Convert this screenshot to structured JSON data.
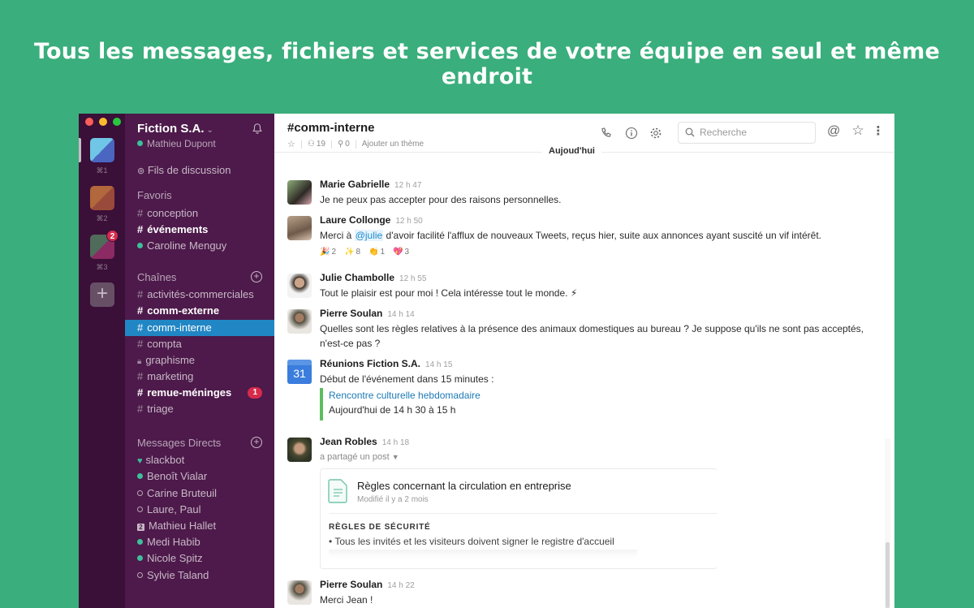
{
  "headline": "Tous les messages, fichiers et services de votre équipe en seul et même endroit",
  "window_controls": {
    "close_color": "#fc5f57",
    "minimize_color": "#fdbc2e",
    "maximize_color": "#27c840"
  },
  "teams": [
    {
      "shortcut": "⌘1",
      "colors": [
        "#6fc6e6",
        "#4a66c1"
      ],
      "badge": null
    },
    {
      "shortcut": "⌘2",
      "colors": [
        "#b2673c",
        "#9a4a3a"
      ],
      "badge": null
    },
    {
      "shortcut": "⌘3",
      "colors": [
        "#4f6b5a",
        "#8b2a63"
      ],
      "badge": "2"
    }
  ],
  "sidebar": {
    "workspace_name": "Fiction S.A.",
    "user_name": "Mathieu Dupont",
    "threads_label": "Fils de discussion",
    "favorites": {
      "title": "Favoris",
      "items": [
        {
          "type": "channel",
          "label": "conception",
          "bold": false
        },
        {
          "type": "channel",
          "label": "événements",
          "bold": true
        },
        {
          "type": "dm-online",
          "label": "Caroline Menguy",
          "bold": false
        }
      ]
    },
    "channels": {
      "title": "Chaînes",
      "items": [
        {
          "type": "channel",
          "label": "activités-commerciales",
          "bold": false
        },
        {
          "type": "channel",
          "label": "comm-externe",
          "bold": true
        },
        {
          "type": "channel",
          "label": "comm-interne",
          "bold": false,
          "selected": true
        },
        {
          "type": "channel",
          "label": "compta",
          "bold": false
        },
        {
          "type": "private",
          "label": "graphisme",
          "bold": false
        },
        {
          "type": "channel",
          "label": "marketing",
          "bold": false
        },
        {
          "type": "channel",
          "label": "remue-méninges",
          "bold": true,
          "badge": "1"
        },
        {
          "type": "channel",
          "label": "triage",
          "bold": false
        }
      ]
    },
    "direct_messages": {
      "title": "Messages Directs",
      "items": [
        {
          "type": "bot",
          "label": "slackbot"
        },
        {
          "type": "online",
          "label": "Benoît Vialar"
        },
        {
          "type": "away",
          "label": "Carine Bruteuil"
        },
        {
          "type": "away",
          "label": "Laure, Paul"
        },
        {
          "type": "group",
          "label": "Mathieu Hallet",
          "count": "2"
        },
        {
          "type": "online",
          "label": "Medi Habib"
        },
        {
          "type": "online",
          "label": "Nicole Spitz"
        },
        {
          "type": "away",
          "label": "Sylvie Taland"
        }
      ]
    }
  },
  "channel_header": {
    "title": "#comm-interne",
    "members": "19",
    "pins": "0",
    "topic_placeholder": "Ajouter un thème",
    "search_placeholder": "Recherche"
  },
  "day_divider": "Aujoud'hui",
  "messages": [
    {
      "author": "Marie Gabrielle",
      "time": "12 h 47",
      "text": "Je ne peux pas accepter pour des raisons personnelles."
    },
    {
      "author": "Laure Collonge",
      "time": "12 h 50",
      "text_before": "Merci à ",
      "mention": "@julie",
      "text_after": " d'avoir facilité l'afflux de nouveaux Tweets, reçus hier, suite aux annonces ayant suscité un vif intérêt.",
      "reactions": [
        {
          "emoji": "🎉",
          "count": "2"
        },
        {
          "emoji": "✨",
          "count": "8"
        },
        {
          "emoji": "👏",
          "count": "1"
        },
        {
          "emoji": "💖",
          "count": "3"
        }
      ]
    },
    {
      "author": "Julie Chambolle",
      "time": "12 h 55",
      "text": "Tout le plaisir est pour moi ! Cela intéresse tout le monde. ⚡"
    },
    {
      "author": "Pierre Soulan",
      "time": "14 h 14",
      "text": "Quelles sont les règles relatives à la présence des animaux domestiques au bureau ? Je suppose qu'ils ne sont pas acceptés, n'est-ce pas ?"
    },
    {
      "author": "Réunions Fiction S.A.",
      "time": "14 h 15",
      "text": "Début de l'événement dans 15 minutes :",
      "calendar_day": "31",
      "attachment": {
        "title": "Rencontre culturelle hebdomadaire",
        "subtitle": "Aujourd'hui de 14 h 30 à 15 h"
      }
    },
    {
      "author": "Jean Robles",
      "time": "14 h 18",
      "text": "a partagé un post",
      "post": {
        "title": "Règles concernant la circulation en entreprise",
        "modified": "Modifié il y a 2 mois",
        "section": "RÈGLES DE SÉCURITÉ",
        "bullet": "• Tous les invités et les visiteurs doivent signer le registre d'accueil"
      }
    },
    {
      "author": "Pierre Soulan",
      "time": "14 h 22",
      "text": "Merci Jean !"
    }
  ]
}
